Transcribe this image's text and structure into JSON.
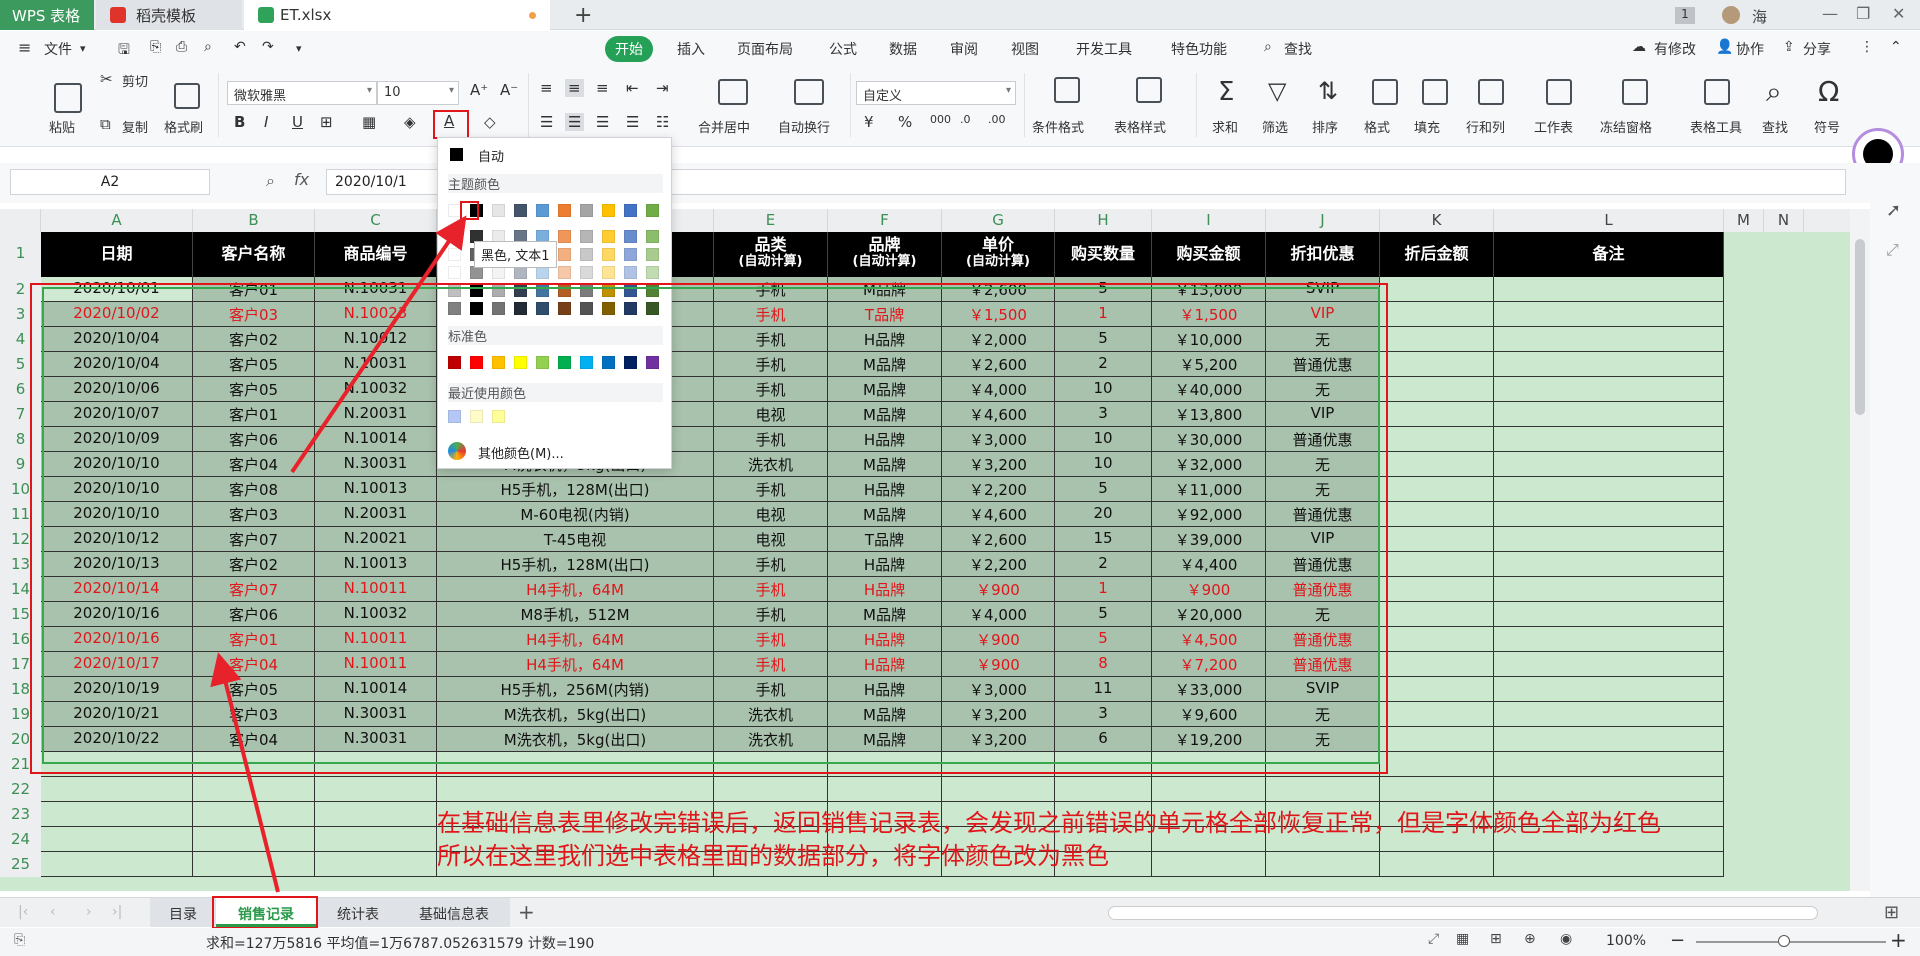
{
  "tabs": [
    {
      "label": "WPS 表格"
    },
    {
      "label": "稻壳模板"
    },
    {
      "label": "ET.xlsx"
    }
  ],
  "window": {
    "badge": "1",
    "user": "海"
  },
  "menu": {
    "file": "文件",
    "items": [
      "开始",
      "插入",
      "页面布局",
      "公式",
      "数据",
      "审阅",
      "视图",
      "开发工具",
      "特色功能"
    ],
    "search": "查找",
    "right": [
      "有修改",
      "协作",
      "分享"
    ]
  },
  "ribbon": {
    "paste": "粘贴",
    "cut": "剪切",
    "copy": "复制",
    "format_painter": "格式刷",
    "font_name": "微软雅黑",
    "font_size": "10",
    "number_format": "自定义",
    "merge": "合并居中",
    "wrap": "自动换行",
    "groups": [
      "条件格式",
      "表格样式",
      "求和",
      "筛选",
      "排序",
      "格式",
      "填充",
      "行和列",
      "工作表",
      "冻结窗格",
      "表格工具",
      "查找",
      "符号"
    ]
  },
  "formula_bar": {
    "name_box": "A2",
    "fx": "fx",
    "value": "2020/10/1"
  },
  "columns": [
    "A",
    "B",
    "C",
    "D",
    "E",
    "F",
    "G",
    "H",
    "I",
    "J",
    "K",
    "L",
    "M",
    "N"
  ],
  "headers": {
    "date": "日期",
    "customer": "客户名称",
    "product_code": "商品编号",
    "category": "品类",
    "category_sub": "(自动计算)",
    "brand": "品牌",
    "brand_sub": "(自动计算)",
    "price": "单价",
    "price_sub": "(自动计算)",
    "qty": "购买数量",
    "amount": "购买金额",
    "discount": "折扣优惠",
    "after": "折后金额",
    "note": "备注"
  },
  "rows": [
    {
      "n": "2",
      "red": false,
      "a": "2020/10/01",
      "b": "客户01",
      "c": "N.10031",
      "d": "",
      "e": "手机",
      "f": "M品牌",
      "g": "￥2,600",
      "h": "5",
      "i": "￥13,000",
      "j": "SVIP"
    },
    {
      "n": "3",
      "red": true,
      "a": "2020/10/02",
      "b": "客户03",
      "c": "N.10023",
      "d": "",
      "e": "手机",
      "f": "T品牌",
      "g": "￥1,500",
      "h": "1",
      "i": "￥1,500",
      "j": "VIP"
    },
    {
      "n": "4",
      "red": false,
      "a": "2020/10/04",
      "b": "客户02",
      "c": "N.10012",
      "d": "",
      "e": "手机",
      "f": "H品牌",
      "g": "￥2,000",
      "h": "5",
      "i": "￥10,000",
      "j": "无"
    },
    {
      "n": "5",
      "red": false,
      "a": "2020/10/04",
      "b": "客户05",
      "c": "N.10031",
      "d": "",
      "e": "手机",
      "f": "M品牌",
      "g": "￥2,600",
      "h": "2",
      "i": "￥5,200",
      "j": "普通优惠"
    },
    {
      "n": "6",
      "red": false,
      "a": "2020/10/06",
      "b": "客户05",
      "c": "N.10032",
      "d": "",
      "e": "手机",
      "f": "M品牌",
      "g": "￥4,000",
      "h": "10",
      "i": "￥40,000",
      "j": "无"
    },
    {
      "n": "7",
      "red": false,
      "a": "2020/10/07",
      "b": "客户01",
      "c": "N.20031",
      "d": "",
      "e": "电视",
      "f": "M品牌",
      "g": "￥4,600",
      "h": "3",
      "i": "￥13,800",
      "j": "VIP"
    },
    {
      "n": "8",
      "red": false,
      "a": "2020/10/09",
      "b": "客户06",
      "c": "N.10014",
      "d": "",
      "e": "手机",
      "f": "H品牌",
      "g": "￥3,000",
      "h": "10",
      "i": "￥30,000",
      "j": "普通优惠"
    },
    {
      "n": "9",
      "red": false,
      "a": "2020/10/10",
      "b": "客户04",
      "c": "N.30031",
      "d": "M洗衣机，5kg(出口)",
      "e": "洗衣机",
      "f": "M品牌",
      "g": "￥3,200",
      "h": "10",
      "i": "￥32,000",
      "j": "无"
    },
    {
      "n": "10",
      "red": false,
      "a": "2020/10/10",
      "b": "客户08",
      "c": "N.10013",
      "d": "H5手机，128M(出口)",
      "e": "手机",
      "f": "H品牌",
      "g": "￥2,200",
      "h": "5",
      "i": "￥11,000",
      "j": "无"
    },
    {
      "n": "11",
      "red": false,
      "a": "2020/10/10",
      "b": "客户03",
      "c": "N.20031",
      "d": "M-60电视(内销)",
      "e": "电视",
      "f": "M品牌",
      "g": "￥4,600",
      "h": "20",
      "i": "￥92,000",
      "j": "普通优惠"
    },
    {
      "n": "12",
      "red": false,
      "a": "2020/10/12",
      "b": "客户07",
      "c": "N.20021",
      "d": "T-45电视",
      "e": "电视",
      "f": "T品牌",
      "g": "￥2,600",
      "h": "15",
      "i": "￥39,000",
      "j": "VIP"
    },
    {
      "n": "13",
      "red": false,
      "a": "2020/10/13",
      "b": "客户02",
      "c": "N.10013",
      "d": "H5手机，128M(出口)",
      "e": "手机",
      "f": "H品牌",
      "g": "￥2,200",
      "h": "2",
      "i": "￥4,400",
      "j": "普通优惠"
    },
    {
      "n": "14",
      "red": true,
      "a": "2020/10/14",
      "b": "客户07",
      "c": "N.10011",
      "d": "H4手机，64M",
      "e": "手机",
      "f": "H品牌",
      "g": "￥900",
      "h": "1",
      "i": "￥900",
      "j": "普通优惠"
    },
    {
      "n": "15",
      "red": false,
      "a": "2020/10/16",
      "b": "客户06",
      "c": "N.10032",
      "d": "M8手机，512M",
      "e": "手机",
      "f": "M品牌",
      "g": "￥4,000",
      "h": "5",
      "i": "￥20,000",
      "j": "无"
    },
    {
      "n": "16",
      "red": true,
      "a": "2020/10/16",
      "b": "客户01",
      "c": "N.10011",
      "d": "H4手机，64M",
      "e": "手机",
      "f": "H品牌",
      "g": "￥900",
      "h": "5",
      "i": "￥4,500",
      "j": "普通优惠"
    },
    {
      "n": "17",
      "red": true,
      "a": "2020/10/17",
      "b": "客户04",
      "c": "N.10011",
      "d": "H4手机，64M",
      "e": "手机",
      "f": "H品牌",
      "g": "￥900",
      "h": "8",
      "i": "￥7,200",
      "j": "普通优惠"
    },
    {
      "n": "18",
      "red": false,
      "a": "2020/10/19",
      "b": "客户05",
      "c": "N.10014",
      "d": "H5手机，256M(内销)",
      "e": "手机",
      "f": "H品牌",
      "g": "￥3,000",
      "h": "11",
      "i": "￥33,000",
      "j": "SVIP"
    },
    {
      "n": "19",
      "red": false,
      "a": "2020/10/21",
      "b": "客户03",
      "c": "N.30031",
      "d": "M洗衣机，5kg(出口)",
      "e": "洗衣机",
      "f": "M品牌",
      "g": "￥3,200",
      "h": "3",
      "i": "￥9,600",
      "j": "无"
    },
    {
      "n": "20",
      "red": false,
      "a": "2020/10/22",
      "b": "客户04",
      "c": "N.30031",
      "d": "M洗衣机，5kg(出口)",
      "e": "洗衣机",
      "f": "M品牌",
      "g": "￥3,200",
      "h": "6",
      "i": "￥19,200",
      "j": "无"
    }
  ],
  "empty_rows": [
    "21",
    "22",
    "23",
    "24",
    "25"
  ],
  "picker": {
    "auto": "自动",
    "theme_label": "主题颜色",
    "standard_label": "标准色",
    "recent_label": "最近使用颜色",
    "more": "其他颜色(M)...",
    "tooltip": "黑色, 文本1",
    "theme_colors": [
      "#ffffff",
      "#000000",
      "#e7e6e6",
      "#44546a",
      "#5b9bd5",
      "#ed7d31",
      "#a5a5a5",
      "#ffc000",
      "#4472c4",
      "#70ad47"
    ],
    "standard_colors": [
      "#c00000",
      "#ff0000",
      "#ffc000",
      "#ffff00",
      "#92d050",
      "#00b050",
      "#00b0f0",
      "#0070c0",
      "#002060",
      "#7030a0"
    ],
    "recent_colors": [
      "#b4c7f5",
      "#fffcc8",
      "#ffff99"
    ]
  },
  "annotation": {
    "line1": "在基础信息表里修改完错误后，返回销售记录表，会发现之前错误的单元格全部恢复正常，但是字体颜色全部为红色",
    "line2": "所以在这里我们选中表格里面的数据部分，将字体颜色改为黑色"
  },
  "sheets": [
    "目录",
    "销售记录",
    "统计表",
    "基础信息表"
  ],
  "status": {
    "summary": "求和=127万5816  平均值=1万6787.052631579  计数=190",
    "zoom": "100%"
  }
}
